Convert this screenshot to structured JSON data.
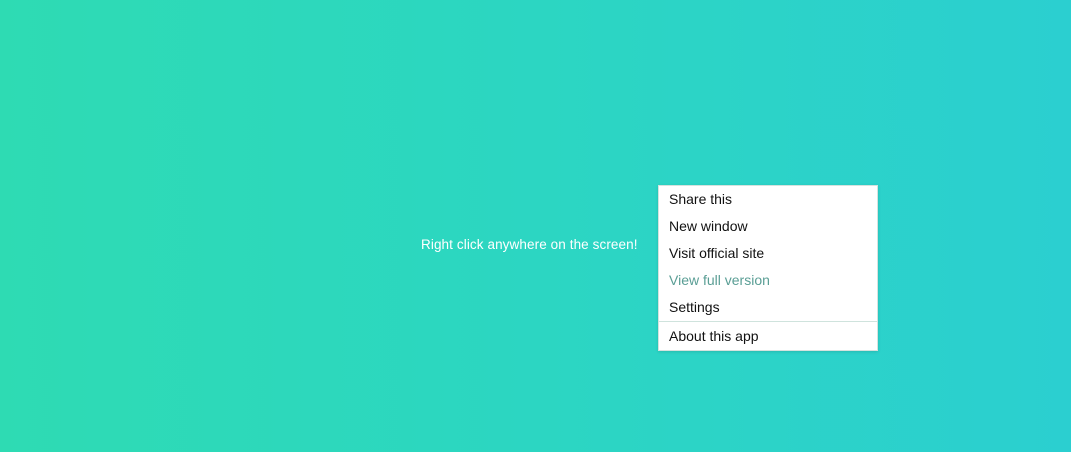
{
  "hint_text": "Right click anywhere on the screen!",
  "context_menu": {
    "items": [
      {
        "label": "Share this",
        "enabled": true
      },
      {
        "label": "New window",
        "enabled": true
      },
      {
        "label": "Visit official site",
        "enabled": true
      },
      {
        "label": "View full version",
        "enabled": false
      },
      {
        "label": "Settings",
        "enabled": true
      }
    ],
    "footer_item": {
      "label": "About this app",
      "enabled": true
    }
  },
  "colors": {
    "background_start": "#2edbb3",
    "background_end": "#2bcfd0",
    "disabled_text": "#5a9e95",
    "menu_text": "#111111"
  }
}
